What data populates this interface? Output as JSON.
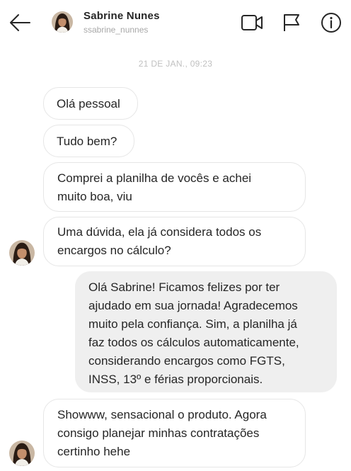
{
  "header": {
    "name": "Sabrine Nunes",
    "handle": "ssabrine_nunnes"
  },
  "icons": {
    "back": "arrow-left-icon",
    "video": "video-camera-icon",
    "flag": "flag-icon",
    "info": "info-icon",
    "avatar": "profile-photo"
  },
  "colors": {
    "incoming_bubble_bg": "#ffffff",
    "incoming_bubble_border": "#e6e6e6",
    "outgoing_bubble_bg": "#efefef",
    "text": "#262626",
    "muted": "#a8a8a8"
  },
  "timestamp": "21 DE JAN., 09:23",
  "messages": [
    {
      "direction": "in",
      "lines": [
        "Olá pessoal"
      ]
    },
    {
      "direction": "in",
      "lines": [
        "Tudo bem?"
      ]
    },
    {
      "direction": "in",
      "lines": [
        "Comprei a planilha de vocês e achei",
        "muito boa, viu"
      ]
    },
    {
      "direction": "in",
      "lines": [
        "Uma dúvida, ela já considera todos os",
        "encargos no cálculo?"
      ]
    },
    {
      "direction": "out",
      "lines": [
        "Olá Sabrine! Ficamos felizes por ter",
        "ajudado em sua jornada! Agradecemos",
        "muito pela confiança. Sim, a planilha já",
        "faz todos os cálculos automaticamente,",
        "considerando encargos como FGTS,",
        "INSS, 13º e férias proporcionais."
      ]
    },
    {
      "direction": "in",
      "lines": [
        "Showww, sensacional o produto. Agora",
        "consigo planejar minhas contratações",
        "certinho hehe"
      ]
    }
  ]
}
